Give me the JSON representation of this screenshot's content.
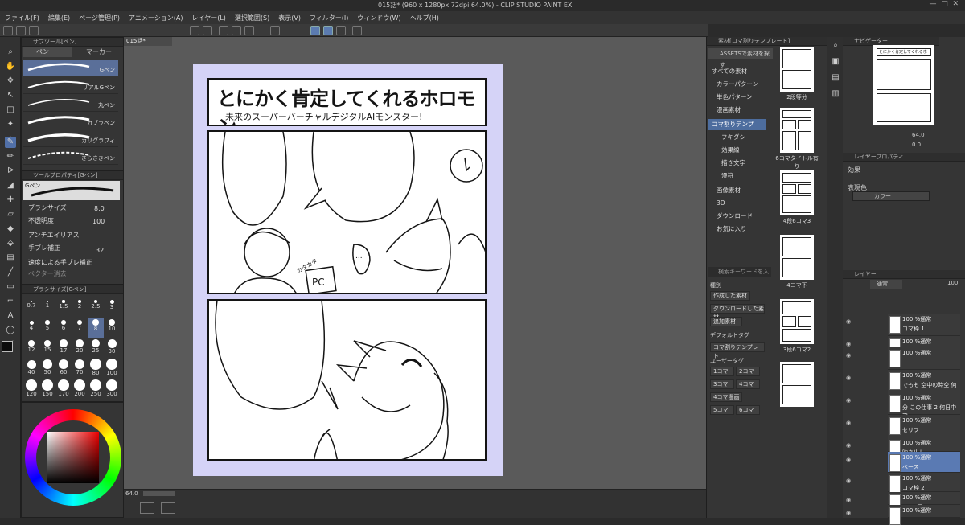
{
  "window": {
    "title": "015話* (960 x 1280px 72dpi 64.0%) - CLIP STUDIO PAINT EX"
  },
  "menu": [
    "ファイル(F)",
    "編集(E)",
    "ページ管理(P)",
    "アニメーション(A)",
    "レイヤー(L)",
    "選択範囲(S)",
    "表示(V)",
    "フィルター(I)",
    "ウィンドウ(W)",
    "ヘルプ(H)"
  ],
  "subtool": {
    "header": "サブツール[ペン]",
    "tab1": "ペン",
    "tab2": "マーカー",
    "brushes": [
      "Gペン",
      "リアルGペン",
      "丸ペン",
      "カブラペン",
      "カリグラフィ",
      "さらさきペン"
    ]
  },
  "toolprop": {
    "header": "ツールプロパティ[Gペン]",
    "name": "Gペン",
    "size_label": "ブラシサイズ",
    "size_value": "8.0",
    "opacity_label": "不透明度",
    "opacity_value": "100",
    "aa_label": "アンチエイリアス",
    "stab_label": "手ブレ補正",
    "stab_value": "32",
    "speed_label": "速度による手ブレ補正",
    "vector_label": "ベクター消去"
  },
  "brushsize": {
    "header": "ブラシサイズ[Gペン]",
    "sizes": [
      "0.7",
      "1",
      "1.5",
      "2",
      "2.5",
      "3",
      "4",
      "5",
      "6",
      "7",
      "8",
      "10",
      "12",
      "15",
      "17",
      "20",
      "25",
      "30",
      "40",
      "50",
      "60",
      "70",
      "80",
      "100",
      "120",
      "150",
      "170",
      "200",
      "250",
      "300"
    ]
  },
  "document": {
    "tab": "015話*",
    "zoom": "64.0"
  },
  "comic": {
    "title": "とにかく肯定してくれるホロモン",
    "subtitle": "未来のスーパーバーチャルデジタルAIモンスター!",
    "sfx": "カタカタ",
    "pc": "PC",
    "dots": "..."
  },
  "materials": {
    "header": "素材[コマ割りテンプレート]",
    "assets_btn": "ASSETSで素材を探す",
    "tree": [
      "すべての素材",
      "カラーパターン",
      "単色パターン",
      "漫画素材",
      "コマ割りテンプ",
      "フキダシ",
      "効果線",
      "描き文字",
      "漫符",
      "画像素材",
      "3D",
      "ダウンロード",
      "お気に入り"
    ],
    "thumbs": [
      "2段等分",
      "6コマタイトル有り",
      "4段6コマ3",
      "4コマ下",
      "3段6コマ2"
    ],
    "search_placeholder": "検索キーワードを入",
    "category": "種別",
    "cats": [
      "作成した素材",
      "ダウンロードした素材",
      "追加素材",
      "デフォルトタグ",
      "コマ割りテンプレート",
      "ユーザータグ"
    ],
    "tags": [
      "1コマ",
      "2コマ",
      "3コマ",
      "4コマ",
      "4コマ漫画",
      "5コマ",
      "6コマ"
    ]
  },
  "navigator": {
    "header": "ナビゲーター",
    "zoom": "64.0",
    "angle": "0.0"
  },
  "layerprop": {
    "header": "レイヤープロパティ",
    "effect": "効果",
    "color_label": "表現色",
    "color_value": "カラー"
  },
  "layers": {
    "header": "レイヤー",
    "blend": "通常",
    "opacity": "100",
    "items": [
      {
        "pct": "100 %通常",
        "name": "コマ枠 1"
      },
      {
        "pct": "100 %通常",
        "name": "1コマ目"
      },
      {
        "pct": "100 %通常",
        "name": "..."
      },
      {
        "pct": "100 %通常",
        "name": "でもも 空中の時空 何"
      },
      {
        "pct": "100 %通常",
        "name": "分 この仕事 2 何日中で"
      },
      {
        "pct": "100 %通常",
        "name": "セリフ"
      },
      {
        "pct": "100 %通常",
        "name": "吹き出し"
      },
      {
        "pct": "100 %通常",
        "name": "ベース"
      },
      {
        "pct": "100 %通常",
        "name": "コマ枠 2"
      },
      {
        "pct": "100 %通常",
        "name": "2コマ目"
      },
      {
        "pct": "100 %通常",
        "name": ""
      }
    ]
  },
  "colors": {
    "accent": "#5170a8",
    "page": "#d5d3f7",
    "ink": "#141414"
  }
}
